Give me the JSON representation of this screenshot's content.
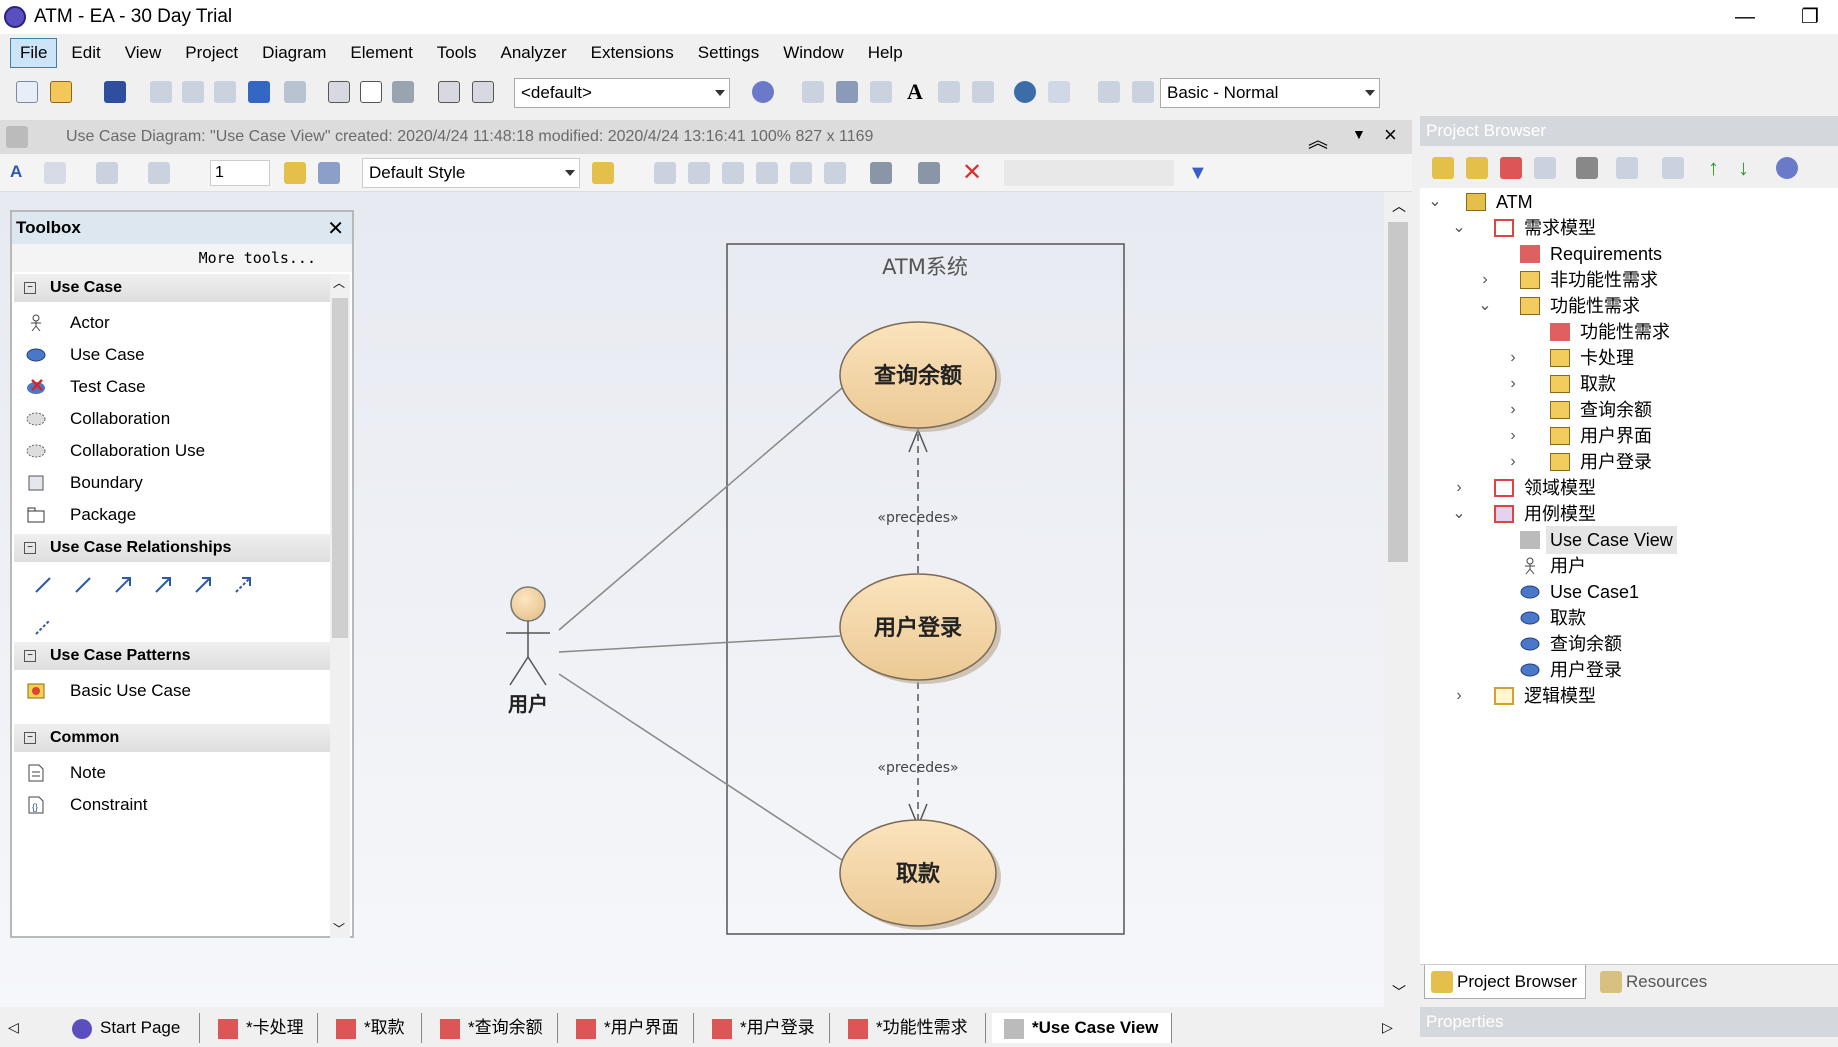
{
  "window": {
    "title": "ATM - EA - 30 Day Trial",
    "minimize": "—",
    "restore": "❐"
  },
  "menu": [
    "File",
    "Edit",
    "View",
    "Project",
    "Diagram",
    "Element",
    "Tools",
    "Analyzer",
    "Extensions",
    "Settings",
    "Window",
    "Help"
  ],
  "toolbar": {
    "view_combo": "<default>",
    "workspace_combo": "Basic - Normal"
  },
  "diagram_header": {
    "info": "Use Case Diagram: \"Use Case View\"   created: 2020/4/24 11:48:18  modified: 2020/4/24 13:16:41   100%   827 x 1169"
  },
  "format_toolbar": {
    "line_width": "1",
    "style_combo": "Default Style"
  },
  "toolbox": {
    "title": "Toolbox",
    "more_tools": "More tools...",
    "sections": [
      {
        "label": "Use Case",
        "items": [
          "Actor",
          "Use Case",
          "Test Case",
          "Collaboration",
          "Collaboration Use",
          "Boundary",
          "Package"
        ]
      },
      {
        "label": "Use Case Relationships",
        "items": []
      },
      {
        "label": "Use Case Patterns",
        "items": [
          "Basic Use Case"
        ]
      },
      {
        "label": "Common",
        "items": [
          "Note",
          "Constraint"
        ]
      }
    ]
  },
  "diagram": {
    "boundary_label": "ATM系统",
    "actor_label": "用户",
    "use_cases": [
      "查询余额",
      "用户登录",
      "取款"
    ],
    "stereotype": "«precedes»"
  },
  "doc_tabs": [
    "Start Page",
    "*卡处理",
    "*取款",
    "*查询余额",
    "*用户界面",
    "*用户登录",
    "*功能性需求",
    "*Use Case View"
  ],
  "project_browser": {
    "title": "Project Browser",
    "tree": [
      {
        "label": "ATM"
      },
      {
        "label": "需求模型"
      },
      {
        "label": "Requirements"
      },
      {
        "label": "非功能性需求"
      },
      {
        "label": "功能性需求"
      },
      {
        "label": "功能性需求"
      },
      {
        "label": "卡处理"
      },
      {
        "label": "取款"
      },
      {
        "label": "查询余额"
      },
      {
        "label": "用户界面"
      },
      {
        "label": "用户登录"
      },
      {
        "label": "领域模型"
      },
      {
        "label": "用例模型"
      },
      {
        "label": "Use Case View"
      },
      {
        "label": "用户"
      },
      {
        "label": "Use Case1"
      },
      {
        "label": "取款"
      },
      {
        "label": "查询余额"
      },
      {
        "label": "用户登录"
      },
      {
        "label": "逻辑模型"
      }
    ],
    "tabs": [
      "Project Browser",
      "Resources"
    ]
  },
  "properties": {
    "title": "Properties"
  }
}
